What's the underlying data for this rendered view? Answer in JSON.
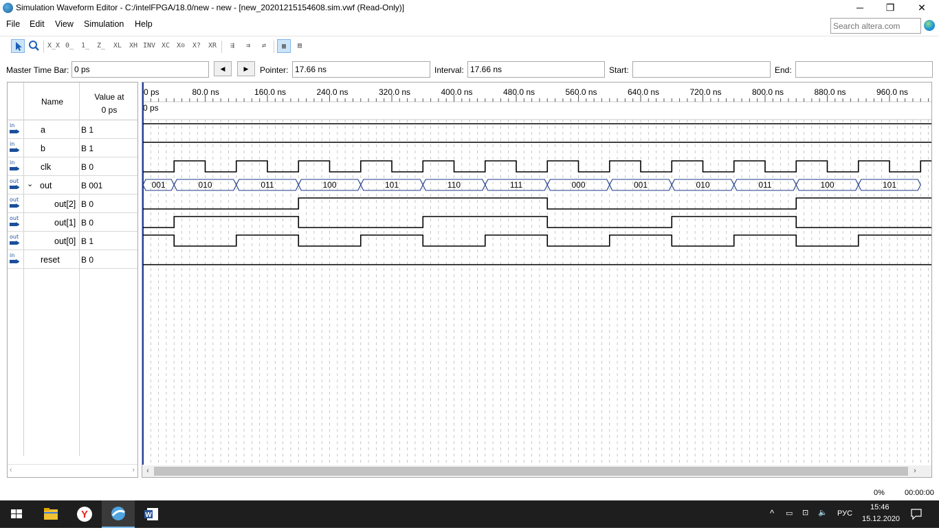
{
  "window": {
    "title": "Simulation Waveform Editor - C:/intelFPGA/18.0/new - new - [new_20201215154608.sim.vwf (Read-Only)]",
    "minimize": "─",
    "maximize": "❐",
    "close": "✕"
  },
  "menu": [
    "File",
    "Edit",
    "View",
    "Simulation",
    "Help"
  ],
  "search": {
    "placeholder": "Search altera.com"
  },
  "toolbar": {
    "buttons": [
      "selection-tool",
      "zoom-tool",
      "forcing-unknown",
      "forcing-low",
      "forcing-high",
      "high-impedance",
      "weak-unknown",
      "weak-low",
      "weak-high",
      "invert",
      "count-value",
      "clock",
      "arbitrary-value",
      "random-value",
      "snap-to-grid",
      "sort",
      "group",
      "overwrite-clock",
      "grid-settings"
    ]
  },
  "timebar": {
    "master_label": "Master Time Bar:",
    "master_value": "0 ps",
    "prev": "◀",
    "next": "▶",
    "pointer_label": "Pointer:",
    "pointer_value": "17.66 ns",
    "interval_label": "Interval:",
    "interval_value": "17.66 ns",
    "start_label": "Start:",
    "start_value": "",
    "end_label": "End:",
    "end_value": ""
  },
  "names_panel": {
    "name_header": "Name",
    "value_header_1": "Value at",
    "value_header_2": "0 ps",
    "signals": [
      {
        "dir": "in",
        "name": "a",
        "value": "B 1"
      },
      {
        "dir": "in",
        "name": "b",
        "value": "B 1"
      },
      {
        "dir": "in",
        "name": "clk",
        "value": "B 0"
      },
      {
        "dir": "out",
        "name": "out",
        "value": "B 001",
        "expanded": true
      },
      {
        "dir": "out",
        "name": "out[2]",
        "value": "B 0"
      },
      {
        "dir": "out",
        "name": "out[1]",
        "value": "B 0"
      },
      {
        "dir": "out",
        "name": "out[0]",
        "value": "B 1"
      },
      {
        "dir": "in",
        "name": "reset",
        "value": "B 0"
      }
    ]
  },
  "wave": {
    "time_labels": [
      "0 ps",
      "80.0 ns",
      "160.0 ns",
      "240.0 ns",
      "320.0 ns",
      "400.0 ns",
      "480.0 ns",
      "560.0 ns",
      "640.0 ns",
      "720.0 ns",
      "800.0 ns",
      "880.0 ns",
      "960.0 ns"
    ],
    "cursor_label": "0 ps",
    "bus_values": [
      "001",
      "010",
      "011",
      "100",
      "101",
      "110",
      "111",
      "000",
      "001",
      "010",
      "011",
      "100",
      "101"
    ]
  },
  "status": {
    "progress": "0%",
    "elapsed": "00:00:00"
  },
  "taskbar": {
    "lang": "РУС",
    "time": "15:46",
    "date": "15.12.2020"
  }
}
